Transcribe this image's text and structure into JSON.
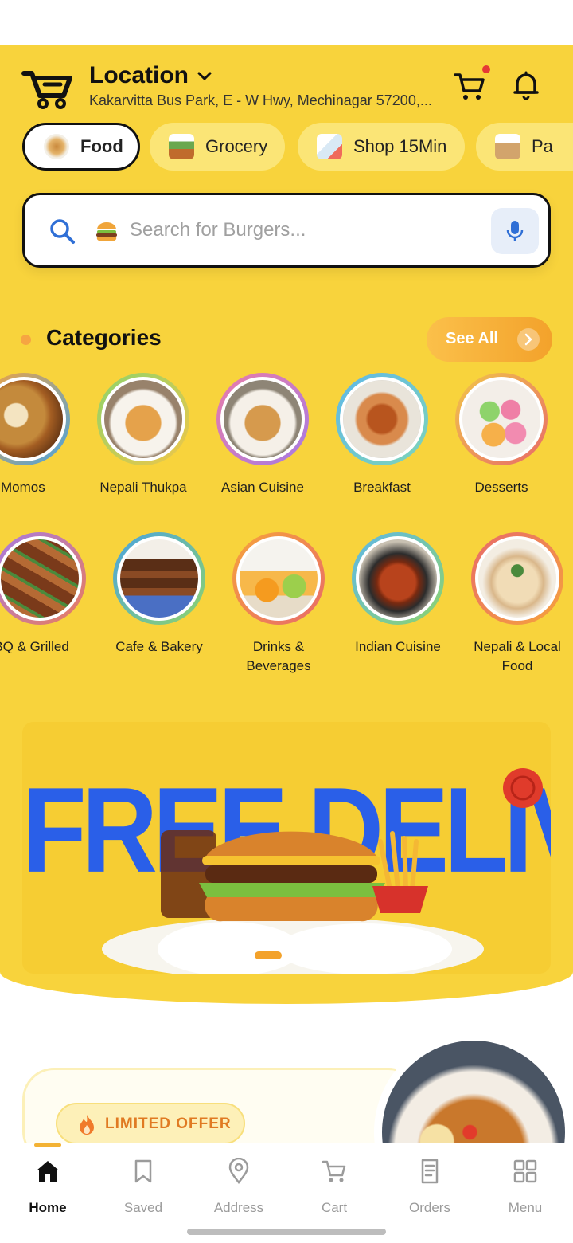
{
  "header": {
    "location_title": "Location",
    "address": "Kakarvitta Bus Park, E - W Hwy, Mechinagar 57200,..."
  },
  "tabs": [
    {
      "label": "Food",
      "active": true
    },
    {
      "label": "Grocery",
      "active": false
    },
    {
      "label": "Shop 15Min",
      "active": false
    },
    {
      "label": "Pa",
      "active": false
    }
  ],
  "search": {
    "placeholder": "Search for Burgers..."
  },
  "categories": {
    "title": "Categories",
    "see_all": "See All",
    "row1": [
      "Momos",
      "Nepali Thukpa",
      "Asian Cuisine",
      "Breakfast",
      "Desserts"
    ],
    "row2": [
      "BBQ & Grilled",
      "Cafe & Bakery",
      "Drinks & Beverages",
      "Indian Cuisine",
      "Nepali & Local Food"
    ]
  },
  "banner": {
    "headline": "FREE DELIVERY"
  },
  "promo": {
    "badge": "LIMITED OFFER"
  },
  "nav": {
    "items": [
      "Home",
      "Saved",
      "Address",
      "Cart",
      "Orders",
      "Menu"
    ],
    "active": "Home"
  },
  "colors": {
    "brand_yellow": "#f8d33c",
    "accent_orange": "#f3a22b",
    "banner_blue": "#2a5fe8"
  }
}
